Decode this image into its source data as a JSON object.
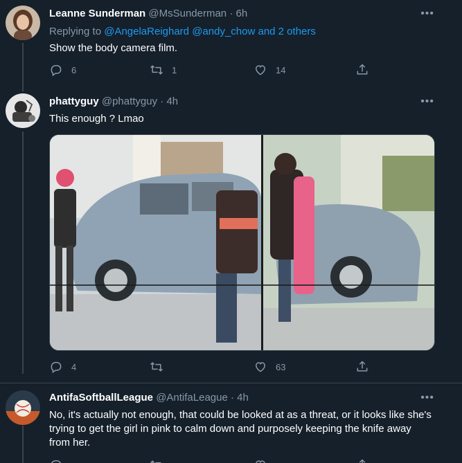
{
  "tweets": [
    {
      "name": "Leanne Sunderman",
      "handle": "@MsSunderman",
      "time": "6h",
      "replying_prefix": "Replying to ",
      "replying_users": "@AngelaReighard @andy_chow",
      "replying_suffix": " and 2 others",
      "text": "Show the body camera film.",
      "replies": "6",
      "retweets": "1",
      "likes": "14"
    },
    {
      "name": "phattyguy",
      "handle": "@phattyguy",
      "time": "4h",
      "text": "This enough ? Lmao",
      "replies": "4",
      "retweets": "",
      "likes": "63"
    },
    {
      "name": "AntifaSoftballLeague",
      "handle": "@AntifaLeague",
      "time": "4h",
      "text": "No, it's actually not enough, that could be looked at as a threat, or it looks like she's trying to get the girl in pink to calm down and purposely keeping the knife away from her."
    }
  ],
  "separator": "·",
  "more_glyph": "•••",
  "icons": {
    "reply": "reply-icon",
    "retweet": "retweet-icon",
    "like": "heart-icon",
    "share": "share-icon",
    "more": "more-icon"
  },
  "colors": {
    "background": "#15202b",
    "secondary_text": "#8899a6",
    "link": "#1d9bf0",
    "divider": "#38444d"
  }
}
